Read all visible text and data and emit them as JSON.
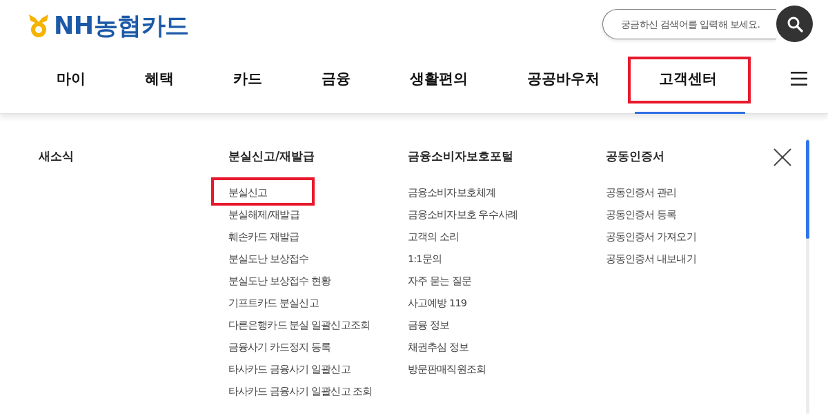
{
  "header": {
    "logo": {
      "text": "NH농협카드"
    },
    "search": {
      "placeholder": "궁금하신 검색어를 입력해 보세요."
    }
  },
  "nav": {
    "items": [
      {
        "label": "마이",
        "selected": false,
        "highlighted": false
      },
      {
        "label": "혜택",
        "selected": false,
        "highlighted": false
      },
      {
        "label": "카드",
        "selected": false,
        "highlighted": false
      },
      {
        "label": "금융",
        "selected": false,
        "highlighted": false
      },
      {
        "label": "생활편의",
        "selected": false,
        "highlighted": false
      },
      {
        "label": "공공바우처",
        "selected": false,
        "highlighted": false
      },
      {
        "label": "고객센터",
        "selected": true,
        "highlighted": true
      }
    ]
  },
  "mega_menu": {
    "columns": [
      {
        "title": "새소식"
      },
      {
        "title": "분실신고/재발급",
        "links": [
          {
            "label": "분실신고",
            "highlighted": true
          },
          {
            "label": "분실해제/재발급",
            "highlighted": false
          },
          {
            "label": "훼손카드 재발급",
            "highlighted": false
          },
          {
            "label": "분실도난 보상접수",
            "highlighted": false
          },
          {
            "label": "분실도난 보상접수 현황",
            "highlighted": false
          },
          {
            "label": "기프트카드 분실신고",
            "highlighted": false
          },
          {
            "label": "다른은행카드 분실 일괄신고조회",
            "highlighted": false
          },
          {
            "label": "금융사기 카드정지 등록",
            "highlighted": false
          },
          {
            "label": "타사카드 금융사기 일괄신고",
            "highlighted": false
          },
          {
            "label": "타사카드 금융사기 일괄신고 조회",
            "highlighted": false
          }
        ]
      },
      {
        "title": "금융소비자보호포털",
        "links": [
          {
            "label": "금융소비자보호체계",
            "highlighted": false
          },
          {
            "label": "금융소비자보호 우수사례",
            "highlighted": false
          },
          {
            "label": "고객의 소리",
            "highlighted": false
          },
          {
            "label": "1:1문의",
            "highlighted": false
          },
          {
            "label": "자주 묻는 질문",
            "highlighted": false
          },
          {
            "label": "사고예방 119",
            "highlighted": false
          },
          {
            "label": "금융 정보",
            "highlighted": false
          },
          {
            "label": "채권추심 정보",
            "highlighted": false
          },
          {
            "label": "방문판매직원조회",
            "highlighted": false
          }
        ]
      },
      {
        "title": "공동인증서",
        "links": [
          {
            "label": "공동인증서 관리",
            "highlighted": false
          },
          {
            "label": "공동인증서 등록",
            "highlighted": false
          },
          {
            "label": "공동인증서 가져오기",
            "highlighted": false
          },
          {
            "label": "공동인증서 내보내기",
            "highlighted": false
          }
        ]
      }
    ]
  }
}
